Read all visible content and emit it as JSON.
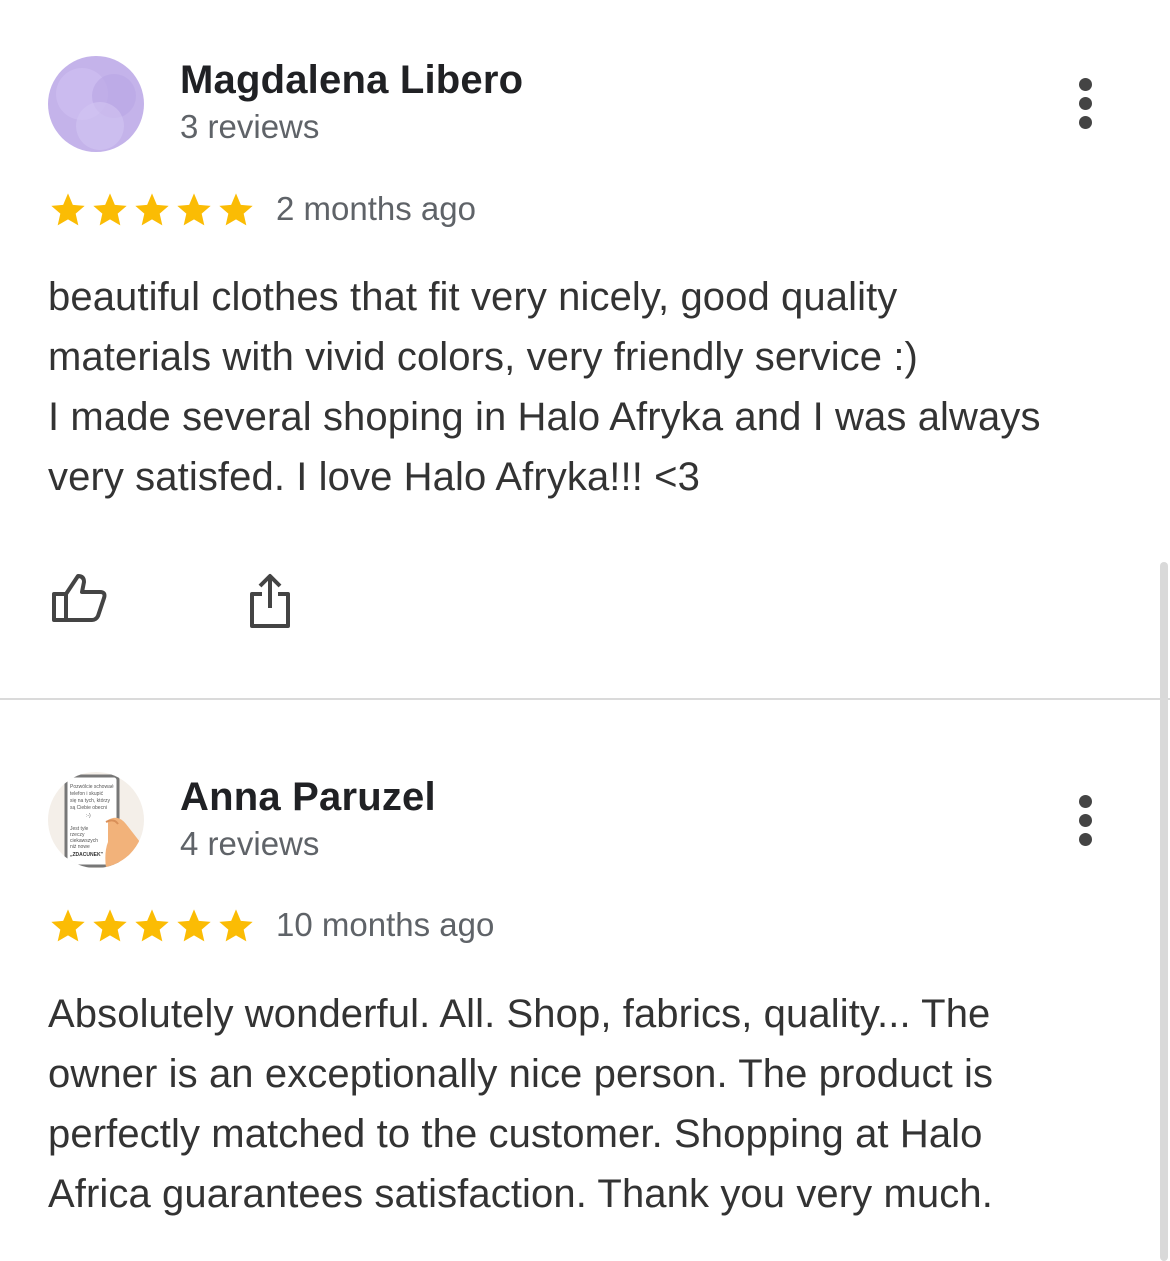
{
  "reviews": [
    {
      "author": "Magdalena Libero",
      "count": "3 reviews",
      "rating": 5,
      "date": "2 months ago",
      "text": "beautiful clothes that fit very nicely, good quality\nmaterials with vivid colors, very friendly service :)\nI made several shoping in Halo Afryka and I was always\nvery satisfed. I love Halo Afryka!!! <3",
      "avatar_color": "#c4b3ea"
    },
    {
      "author": "Anna Paruzel",
      "count": "4 reviews",
      "rating": 5,
      "date": "10 months ago",
      "text": "Absolutely wonderful. All. Shop, fabrics, quality... The\nowner is an exceptionally nice person. The product is\nperfectly matched to the customer. Shopping at Halo\nAfrica guarantees satisfaction. Thank you very much.",
      "avatar_image_text": [
        "Pozwólcie schowaé",
        "telefon i skupić",
        "się na tych, którzy",
        "są Ciebie obecni",
        ":-)",
        "Jest tyle",
        "rzeczy",
        "ciekawszych",
        "niż nowe",
        "„ZDACUNEK”"
      ]
    }
  ],
  "colors": {
    "star": "#fbbc04",
    "icon": "#444444",
    "divider": "#dadada"
  },
  "icons": [
    "star-icon",
    "more-vert-icon",
    "thumb-up-icon",
    "share-icon"
  ]
}
